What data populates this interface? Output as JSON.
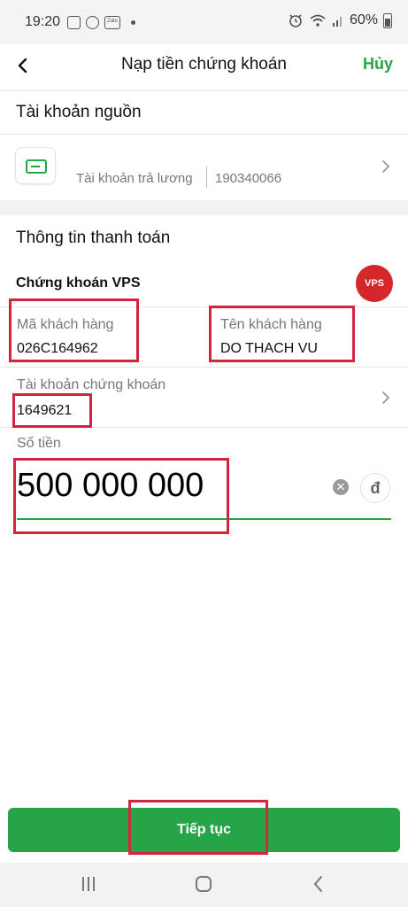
{
  "status_bar": {
    "time": "19:20",
    "battery": "60%"
  },
  "header": {
    "title": "Nạp tiền chứng khoán",
    "cancel_label": "Hủy"
  },
  "source": {
    "section_title": "Tài khoản nguồn",
    "account_label": "Tài khoản trả lương",
    "account_number": "190340066"
  },
  "payment": {
    "section_title": "Thông tin thanh toán",
    "provider_name": "Chứng khoán VPS",
    "provider_logo_text": "VPS",
    "customer_code_label": "Mã khách hàng",
    "customer_code_value": "026C164962",
    "customer_name_label": "Tên khách hàng",
    "customer_name_value": "DO THACH VU",
    "securities_account_label": "Tài khoản chứng khoán",
    "securities_account_value": "1649621",
    "amount_label": "Số tiền",
    "amount_value": "500 000 000",
    "currency_symbol": "đ"
  },
  "footer": {
    "continue_label": "Tiếp tục"
  },
  "colors": {
    "accent": "#27a644",
    "highlight": "#d1263d",
    "vps_brand": "#d3272c"
  },
  "icons": [
    "image-icon",
    "viber-icon",
    "zalo-icon",
    "alarm-icon",
    "wifi-icon",
    "signal-icon",
    "battery-icon",
    "back-arrow-icon",
    "card-icon",
    "chevron-right-icon",
    "clear-icon",
    "recents-icon",
    "home-icon",
    "back-icon"
  ]
}
